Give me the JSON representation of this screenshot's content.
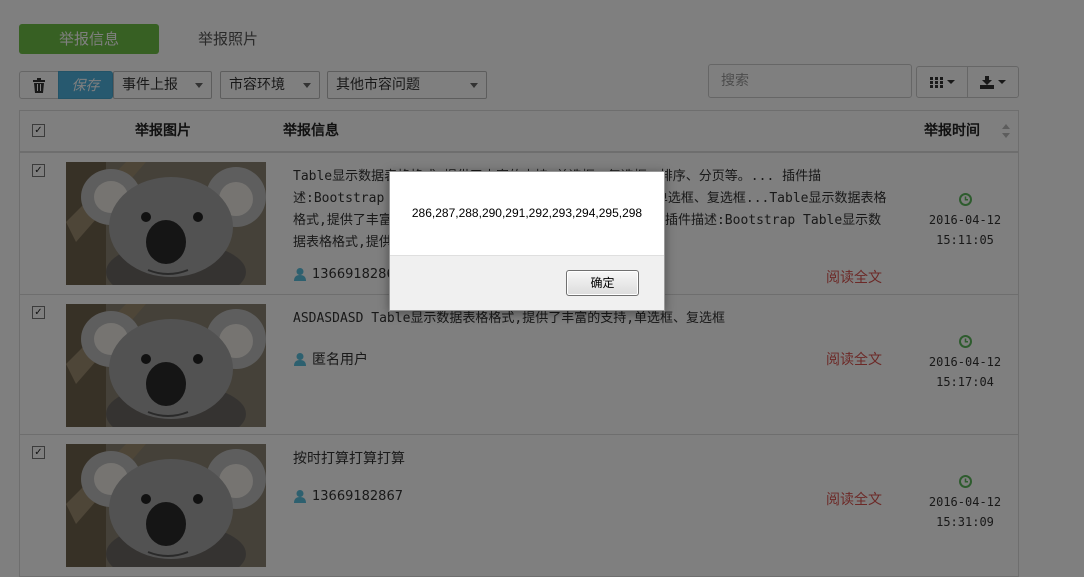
{
  "tabs": [
    {
      "label": "举报信息",
      "active": true
    },
    {
      "label": "举报照片",
      "active": false
    }
  ],
  "toolbar": {
    "save_label": "保存",
    "selects": [
      "事件上报",
      "市容环境",
      "其他市容问题"
    ],
    "search_placeholder": "搜索"
  },
  "table": {
    "headers": {
      "image": "举报图片",
      "info": "举报信息",
      "time": "举报时间"
    },
    "rows": [
      {
        "checked": true,
        "info_lines": [
          "Table显示数据表格格式,提供了丰富的支持,单选框、复选框、排序、分页等。...  插件描",
          "述:Bootstrap Table显示数据表格格式,提供了丰富的支持,单选框、复选框...Table显示数据表格",
          "格式,提供了丰富的支持,单选框、复选框、排序、分页等。...  插件描述:Bootstrap Table显示数",
          "据表格格式,提供了丰富的支持"
        ],
        "user": "13669182867",
        "read_more": "阅读全文",
        "date": "2016-04-12",
        "time": "15:11:05"
      },
      {
        "checked": true,
        "info_lines": [
          "ASDASDASD Table显示数据表格格式,提供了丰富的支持,单选框、复选框"
        ],
        "user": "匿名用户",
        "read_more": "阅读全文",
        "date": "2016-04-12",
        "time": "15:17:04"
      },
      {
        "checked": true,
        "info_lines": [
          "按时打算打算打算"
        ],
        "user": "13669182867",
        "read_more": "阅读全文",
        "date": "2016-04-12",
        "time": "15:31:09"
      }
    ]
  },
  "dialog": {
    "message": "286,287,288,290,291,292,293,294,295,298",
    "ok_label": "确定"
  },
  "colors": {
    "tab_active": "#6ec046",
    "save_button": "#4fb3df",
    "read_more": "#d9534f",
    "clock": "#5cb85c",
    "user_icon": "#5bc0de"
  }
}
